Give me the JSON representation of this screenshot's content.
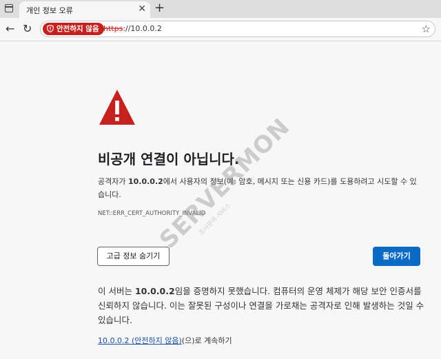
{
  "tab": {
    "title": "개인 정보 오류",
    "close": "✕"
  },
  "new_tab": "+",
  "nav": {
    "back": "←",
    "reload": "↻"
  },
  "address": {
    "badge": "안전하지 않음",
    "scheme": "https",
    "rest": "://10.0.0.2",
    "star": "☆"
  },
  "page": {
    "headline": "비공개 연결이 아닙니다.",
    "desc_prefix": "공격자가 ",
    "desc_host": "10.0.0.2",
    "desc_suffix": "에서 사용자의 정보(예: 암호, 메시지 또는 신용 카드)를 도용하려고 시도할 수 있습니다.",
    "error_code": "NET::ERR_CERT_AUTHORITY_INVALID",
    "advanced_btn": "고급 정보 숨기기",
    "back_btn": "돌아가기",
    "detail_prefix": "이 서버는 ",
    "detail_host": "10.0.0.2",
    "detail_suffix": "임을 증명하지 못했습니다. 컴퓨터의 운영 체제가 해당 보안 인증서를 신뢰하지 않습니다. 이는 잘못된 구성이나 연결을 가로채는 공격자로 인해 발생하는 것일 수 있습니다.",
    "proceed_link": "10.0.0.2 (안전하지 않음)",
    "proceed_suffix": "(으)로 계속하기"
  },
  "watermark": {
    "main": "SERVERMON",
    "sub": "조사문의 서비스"
  },
  "colors": {
    "danger": "#c5221f",
    "primary": "#0b6bc4",
    "watermark_green": "#8fc31f"
  }
}
